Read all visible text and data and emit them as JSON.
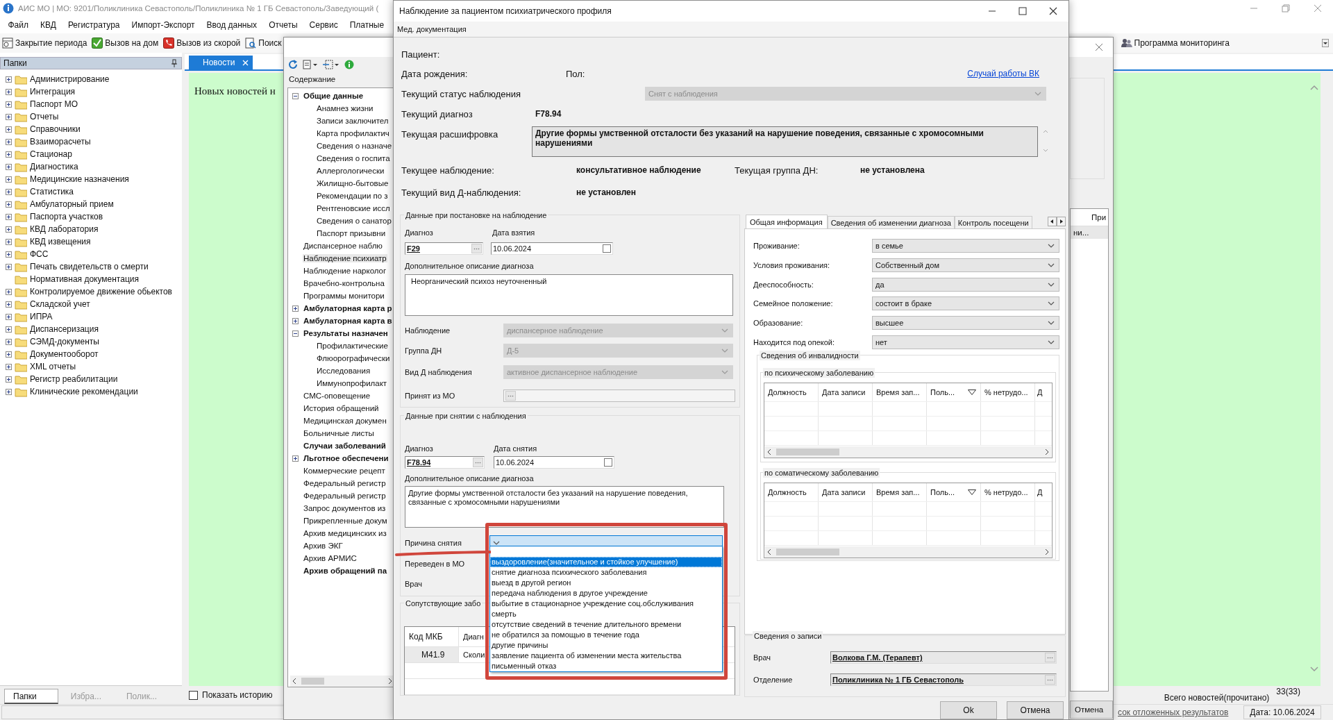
{
  "app": {
    "title": "АИС МО | МО: 9201/Поликлиника Севастополь/Поликлиника № 1 ГБ Севастополь/Заведующий (",
    "menu": [
      "Файл",
      "КВД",
      "Регистратура",
      "Импорт-Экспорт",
      "Ввод данных",
      "Отчеты",
      "Сервис",
      "Платные"
    ],
    "toolbar": [
      "Закрытие периода",
      "Вызов на дом",
      "Вызов из скорой",
      "Поиск"
    ],
    "toolbar_right": [
      "Программа мониторинга"
    ],
    "folders": {
      "title": "Папки",
      "items": [
        {
          "label": "Администрирование",
          "expandable": true
        },
        {
          "label": "Интеграция",
          "expandable": true
        },
        {
          "label": "Паспорт МО",
          "expandable": true
        },
        {
          "label": "Отчеты",
          "expandable": true
        },
        {
          "label": "Справочники",
          "expandable": true
        },
        {
          "label": "Взаиморасчеты",
          "expandable": true
        },
        {
          "label": "Стационар",
          "expandable": true
        },
        {
          "label": "Диагностика",
          "expandable": true
        },
        {
          "label": "Медицинские назначения",
          "expandable": true
        },
        {
          "label": "Статистика",
          "expandable": true
        },
        {
          "label": "Амбулаторный прием",
          "expandable": true
        },
        {
          "label": "Паспорта участков",
          "expandable": true
        },
        {
          "label": "КВД лаборатория",
          "expandable": true
        },
        {
          "label": "КВД извещения",
          "expandable": true
        },
        {
          "label": "ФСС",
          "expandable": true
        },
        {
          "label": "Печать свидетельств о смерти",
          "expandable": true
        },
        {
          "label": "Нормативная документация",
          "expandable": false
        },
        {
          "label": "Контролируемое движение обьектов",
          "expandable": true
        },
        {
          "label": "Складской учет",
          "expandable": true
        },
        {
          "label": "ИПРА",
          "expandable": true
        },
        {
          "label": "Диспансеризация",
          "expandable": true
        },
        {
          "label": "СЭМД-документы",
          "expandable": true
        },
        {
          "label": "Документооборот",
          "expandable": true
        },
        {
          "label": "XML отчеты",
          "expandable": true
        },
        {
          "label": "Регистр реабилитации",
          "expandable": true
        },
        {
          "label": "Клинические рекомендации",
          "expandable": true
        }
      ],
      "tabs": [
        {
          "label": "Папки",
          "selected": true
        },
        {
          "label": "Избра...",
          "selected": false
        },
        {
          "label": "Полик...",
          "selected": false
        }
      ]
    },
    "news": {
      "tab": "Новости",
      "message": "Новых новостей н",
      "show_history": {
        "label": "Показать историю",
        "checked": false
      },
      "total_label": "Всего новостей(прочитано)",
      "total_count": "33(33)"
    },
    "status_bar": {
      "link": "сок отложенных результатов",
      "date": "Дата: 10.06.2024"
    }
  },
  "record_window": {
    "contents_label": "Содержание",
    "tree": [
      {
        "label": "Общие данные",
        "bold": true,
        "selected": false,
        "expanded": true,
        "children": [
          {
            "label": "Анамнез жизни",
            "bold": false,
            "selected": false
          },
          {
            "label": "Записи заключител",
            "bold": false,
            "selected": false
          },
          {
            "label": "Карта профилактич",
            "bold": false,
            "selected": false
          },
          {
            "label": "Сведения о назначе",
            "bold": false,
            "selected": false
          },
          {
            "label": "Сведения о госпита",
            "bold": false,
            "selected": false
          },
          {
            "label": "Аллергологически",
            "bold": false,
            "selected": false
          },
          {
            "label": "Жилищно-бытовые",
            "bold": false,
            "selected": false
          },
          {
            "label": "Рекомендации по з",
            "bold": false,
            "selected": false
          },
          {
            "label": "Рентгеновские иссл",
            "bold": false,
            "selected": false
          },
          {
            "label": "Сведения о санатор",
            "bold": false,
            "selected": false
          },
          {
            "label": "Паспорт призывни",
            "bold": false,
            "selected": false
          }
        ]
      },
      {
        "label": "Диспансерное наблю",
        "bold": false,
        "selected": false
      },
      {
        "label": "Наблюдение психиатр",
        "bold": false,
        "selected": true
      },
      {
        "label": "Наблюдение нарколог",
        "bold": false,
        "selected": false
      },
      {
        "label": "Врачебно-контрольна",
        "bold": false,
        "selected": false
      },
      {
        "label": "Программы монитори",
        "bold": false,
        "selected": false
      },
      {
        "label": "Амбулаторная карта р",
        "bold": true,
        "selected": false,
        "expanded": false
      },
      {
        "label": "Амбулаторная карта в",
        "bold": true,
        "selected": false,
        "expanded": false
      },
      {
        "label": "Результаты назначен",
        "bold": true,
        "selected": false,
        "expanded": true,
        "children": [
          {
            "label": "Профилактические",
            "bold": false,
            "selected": false
          },
          {
            "label": "Флюорографически",
            "bold": false,
            "selected": false
          },
          {
            "label": "Исследования",
            "bold": false,
            "selected": false
          },
          {
            "label": "Иммунопрофилакт",
            "bold": false,
            "selected": false
          }
        ]
      },
      {
        "label": "СМС-оповещение",
        "bold": false,
        "selected": false
      },
      {
        "label": "История обращений",
        "bold": false,
        "selected": false
      },
      {
        "label": "Медицинская докумен",
        "bold": false,
        "selected": false
      },
      {
        "label": "Больничные листы",
        "bold": false,
        "selected": false
      },
      {
        "label": "Случаи заболеваний",
        "bold": true,
        "selected": false
      },
      {
        "label": "Льготное обеспечени",
        "bold": true,
        "selected": false,
        "expanded": false
      },
      {
        "label": "Коммерческие рецепт",
        "bold": false,
        "selected": false
      },
      {
        "label": "Федеральный регистр",
        "bold": false,
        "selected": false
      },
      {
        "label": "Федеральный регистр",
        "bold": false,
        "selected": false
      },
      {
        "label": "Запрос документов из",
        "bold": false,
        "selected": false
      },
      {
        "label": "Прикрепленные докум",
        "bold": false,
        "selected": false
      },
      {
        "label": "Архив медицинских из",
        "bold": false,
        "selected": false
      },
      {
        "label": "Архив ЭКГ",
        "bold": false,
        "selected": false
      },
      {
        "label": "Архив АРМИС",
        "bold": false,
        "selected": false
      },
      {
        "label": "Архив обращений па",
        "bold": true,
        "selected": false
      }
    ],
    "column_header": "При",
    "cell": "ни...",
    "cancel_button": "Отмена"
  },
  "dialog": {
    "title": "Наблюдение за пациентом психиатрического профиля",
    "menu": [
      "Мед. документация"
    ],
    "patient_label": "Пациент:",
    "birth_label": "Дата рождения:",
    "sex_label": "Пол:",
    "vk_link": "Случай работы ВК",
    "status": {
      "label": "Текущий статус наблюдения",
      "value": "Снят с наблюдения",
      "disabled": true
    },
    "current_diagnosis": {
      "label": "Текущий диагноз",
      "value": "F78.94"
    },
    "decoding": {
      "label": "Текущая расшифровка",
      "value": "Другие формы умственной отсталости без указаний на нарушение поведения, связанные с хромосомными нарушениями"
    },
    "current_observation": {
      "label": "Текущее наблюдение:",
      "value": "консультативное наблюдение"
    },
    "current_group": {
      "label": "Текущая группа ДН:",
      "value": "не установлена"
    },
    "current_kind": {
      "label": "Текущий вид Д-наблюдения:",
      "value": "не установлен"
    },
    "registration": {
      "title": "Данные при постановке на наблюдение",
      "diagnosis_label": "Диагноз",
      "diagnosis": "F29",
      "date_label": "Дата взятия",
      "date": "10.06.2024",
      "date_checked": false,
      "description_label": "Дополнительное описание диагноза",
      "description": "Неорганический психоз неуточненный",
      "fields": [
        {
          "label": "Наблюдение",
          "kind": "combo",
          "value": "диспансерное наблюдение",
          "disabled": true
        },
        {
          "label": "Группа ДН",
          "kind": "combo",
          "value": "Д-5",
          "disabled": true
        },
        {
          "label": "Вид Д наблюдения",
          "kind": "combo",
          "value": "активное диспансерное наблюдение",
          "disabled": true
        },
        {
          "label": "Принят из МО",
          "kind": "lookup",
          "disabled": true
        }
      ]
    },
    "deregistration": {
      "title": "Данные при снятии с наблюдения",
      "diagnosis_label": "Диагноз",
      "diagnosis": "F78.94",
      "date_label": "Дата снятия",
      "date": "10.06.2024",
      "date_checked": false,
      "description_label": "Дополнительное описание диагноза",
      "description": "Другие формы умственной отсталости без указаний на нарушение поведения, связанные с хромосомными нарушениями",
      "reason_label": "Причина снятия",
      "reason_expanded": true,
      "reason_options": [
        {
          "label": "выздоровление(значительное и стойкое улучшение)",
          "selected": true
        },
        {
          "label": "снятие диагноза психического заболевания",
          "selected": false
        },
        {
          "label": "выезд в другой регион",
          "selected": false
        },
        {
          "label": "передача наблюдения в другое учреждение",
          "selected": false
        },
        {
          "label": "выбытие в стационарное учреждение соц.обслуживания",
          "selected": false
        },
        {
          "label": "смерть",
          "selected": false
        },
        {
          "label": "отсутствие сведений в течение длительного времени",
          "selected": false
        },
        {
          "label": "не обратился за помощью в течение года",
          "selected": false
        },
        {
          "label": "другие причины",
          "selected": false
        },
        {
          "label": "заявление пациента об изменении места жительства",
          "selected": false
        },
        {
          "label": "письменный отказ",
          "selected": false
        }
      ],
      "transferred_label": "Переведен в МО",
      "doctor_label": "Врач"
    },
    "comorbid": {
      "title": "Сопутствующие забо",
      "columns": [
        "Код МКБ",
        "Диагн"
      ],
      "rows": [
        [
          "M41.9",
          "Сколи"
        ]
      ]
    },
    "tabs": [
      {
        "label": "Общая информация",
        "selected": true
      },
      {
        "label": "Сведения об изменении диагноза",
        "selected": false
      },
      {
        "label": "Контроль посещени",
        "selected": false
      }
    ],
    "general": [
      {
        "label": "Проживание:",
        "value": "в семье",
        "disabled": false
      },
      {
        "label": "Условия проживания:",
        "value": "Собственный дом",
        "disabled": false
      },
      {
        "label": "Дееспособность:",
        "value": "да",
        "disabled": false
      },
      {
        "label": "Семейное положение:",
        "value": "состоит в браке",
        "disabled": false
      },
      {
        "label": "Образование:",
        "value": "высшее",
        "disabled": false
      },
      {
        "label": "Находится под опекой:",
        "value": "нет",
        "disabled": false
      }
    ],
    "disability": {
      "title": "Сведения об инвалидности",
      "grids": [
        {
          "title": "по психическому заболеванию",
          "columns": [
            "Должность",
            "Дата записи",
            "Время зап...",
            "Поль...",
            "% нетрудо...",
            "Д"
          ]
        },
        {
          "title": "по соматическому заболеванию",
          "columns": [
            "Должность",
            "Дата записи",
            "Время зап...",
            "Поль...",
            "% нетрудо...",
            "Д"
          ]
        }
      ]
    },
    "record_info": {
      "title": "Сведения о записи",
      "fields": [
        {
          "label": "Врач",
          "value": "Волкова Г.М. (Терапевт)"
        },
        {
          "label": "Отделение",
          "value": "Поликлиника № 1 ГБ Севастополь"
        }
      ]
    },
    "buttons": [
      "Ok",
      "Отмена"
    ]
  }
}
